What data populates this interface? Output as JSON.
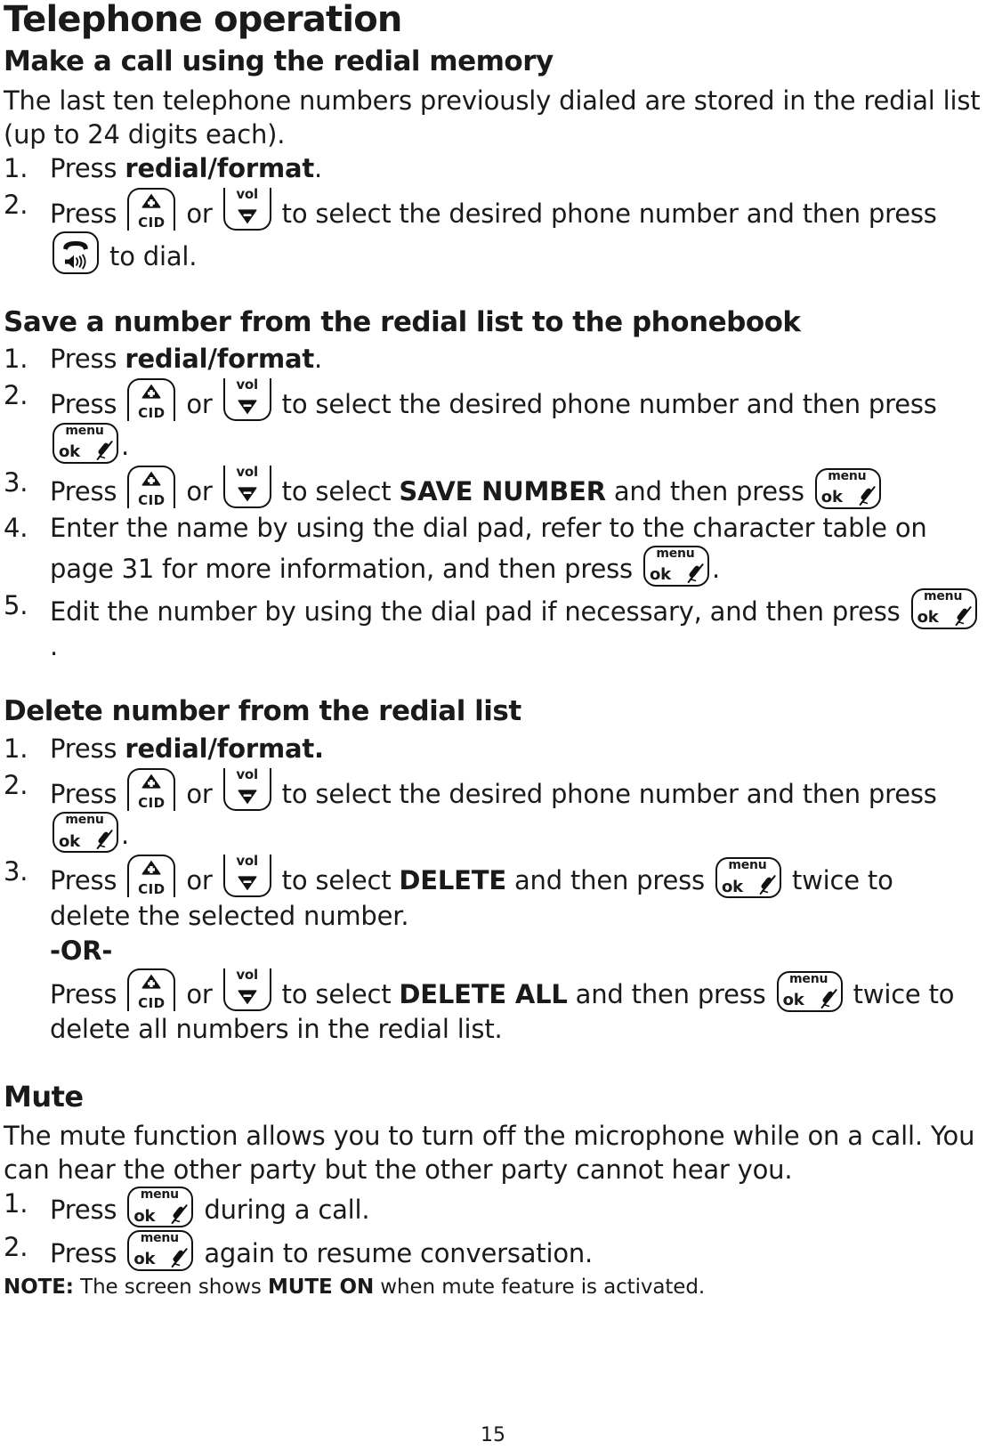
{
  "page": {
    "chapter_title": "Telephone operation",
    "page_number": "15"
  },
  "keys": {
    "cid": {
      "label": "CID",
      "icon": "triangle-up-plus-icon",
      "name": "cid-key"
    },
    "vol": {
      "label": "vol",
      "icon": "triangle-down-icon",
      "name": "vol-key"
    },
    "talk": {
      "icon": "handset-speaker-icon",
      "name": "speakerphone-key"
    },
    "menuok": {
      "label_top": "menu",
      "label_bottom": "ok",
      "icon": "mic-mute-icon",
      "name": "menu-ok-key"
    }
  },
  "sections": [
    {
      "heading": "Make a call using the redial memory",
      "intro": "The last ten telephone numbers previously dialed are stored in the redial list (up to 24 digits each).",
      "steps": [
        {
          "num": "1.",
          "parts": [
            {
              "t": "Press "
            },
            {
              "b": "redial/format"
            },
            {
              "t": "."
            }
          ]
        },
        {
          "num": "2.",
          "parts": [
            {
              "t": "Press "
            },
            {
              "key": "cid"
            },
            {
              "t": " or "
            },
            {
              "key": "vol"
            },
            {
              "t": " to select the desired phone number and then press "
            },
            {
              "key": "talk"
            },
            {
              "t": " to dial."
            }
          ]
        }
      ]
    },
    {
      "heading": "Save a number from the redial list to the phonebook",
      "steps": [
        {
          "num": "1.",
          "parts": [
            {
              "t": "Press "
            },
            {
              "b": "redial/format"
            },
            {
              "t": "."
            }
          ]
        },
        {
          "num": "2.",
          "parts": [
            {
              "t": "Press "
            },
            {
              "key": "cid"
            },
            {
              "t": " or "
            },
            {
              "key": "vol"
            },
            {
              "t": " to select the desired phone number and then press "
            },
            {
              "key": "menuok"
            },
            {
              "t": "."
            }
          ]
        },
        {
          "num": "3.",
          "parts": [
            {
              "t": "Press "
            },
            {
              "key": "cid"
            },
            {
              "t": " or "
            },
            {
              "key": "vol"
            },
            {
              "t": " to select "
            },
            {
              "b": "SAVE NUMBER"
            },
            {
              "t": " and then press "
            },
            {
              "key": "menuok"
            }
          ]
        },
        {
          "num": "4.",
          "parts": [
            {
              "t": "Enter the name by using the dial pad, refer to the character table on page 31 for more information, and then press "
            },
            {
              "key": "menuok"
            },
            {
              "t": "."
            }
          ]
        },
        {
          "num": "5.",
          "parts": [
            {
              "t": "Edit the number by using the dial pad if necessary, and then press "
            },
            {
              "key": "menuok"
            },
            {
              "t": "."
            }
          ]
        }
      ]
    },
    {
      "heading": "Delete number from the redial list",
      "steps": [
        {
          "num": "1.",
          "parts": [
            {
              "t": "Press "
            },
            {
              "b": "redial/format."
            }
          ]
        },
        {
          "num": "2.",
          "parts": [
            {
              "t": "Press "
            },
            {
              "key": "cid"
            },
            {
              "t": " or "
            },
            {
              "key": "vol"
            },
            {
              "t": " to select the desired phone number and then press "
            },
            {
              "key": "menuok"
            },
            {
              "t": "."
            }
          ]
        },
        {
          "num": "3.",
          "parts": [
            {
              "t": "Press "
            },
            {
              "key": "cid"
            },
            {
              "t": " or "
            },
            {
              "key": "vol"
            },
            {
              "t": " to select "
            },
            {
              "b": "DELETE"
            },
            {
              "t": " and then press "
            },
            {
              "key": "menuok"
            },
            {
              "t": " twice to delete the selected number."
            },
            {
              "br": true
            },
            {
              "b": "-OR-"
            },
            {
              "br": true
            },
            {
              "t": "Press "
            },
            {
              "key": "cid"
            },
            {
              "t": " or "
            },
            {
              "key": "vol"
            },
            {
              "t": " to select "
            },
            {
              "b": "DELETE ALL"
            },
            {
              "t": " and then press "
            },
            {
              "key": "menuok"
            },
            {
              "t": " twice to delete all numbers in the redial list."
            }
          ]
        }
      ]
    },
    {
      "heading": "Mute",
      "intro": "The mute function allows you to turn off the microphone while on a call. You can hear the other party but the other party cannot hear you.",
      "steps": [
        {
          "num": "1.",
          "parts": [
            {
              "t": "Press "
            },
            {
              "key": "menuok"
            },
            {
              "t": " during a call."
            }
          ]
        },
        {
          "num": "2.",
          "parts": [
            {
              "t": "Press "
            },
            {
              "key": "menuok"
            },
            {
              "t": " again to resume conversation."
            }
          ]
        }
      ],
      "note": {
        "label": "NOTE:",
        "text_before": " The screen shows ",
        "bold": "MUTE ON",
        "text_after": " when mute feature is activated."
      }
    }
  ]
}
